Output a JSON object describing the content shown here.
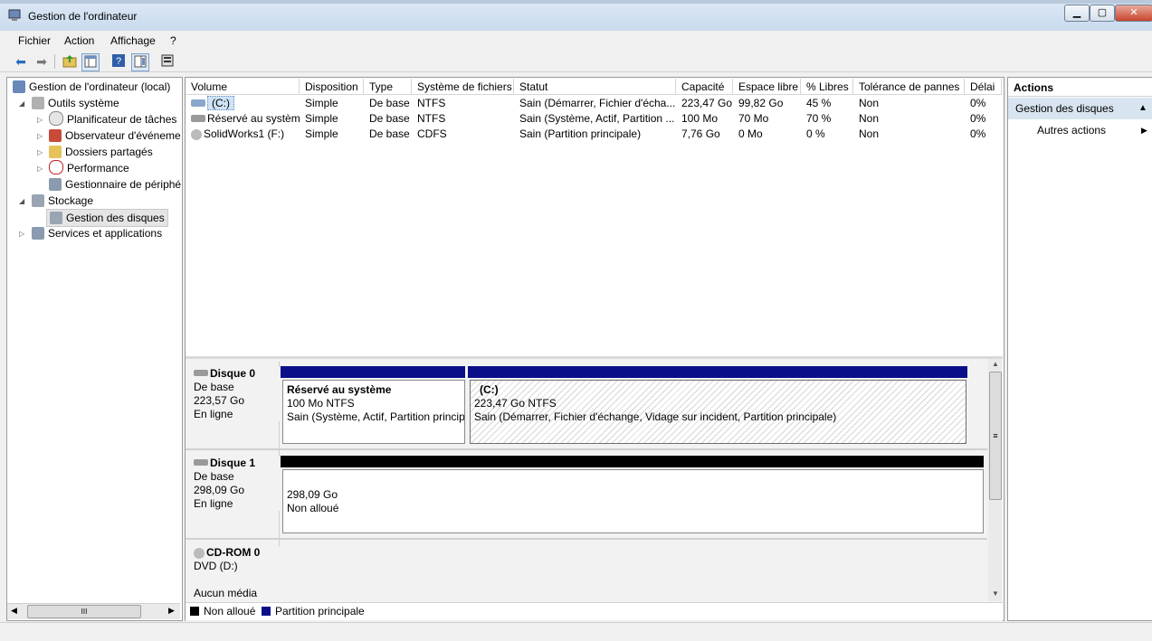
{
  "window": {
    "title": "Gestion de l'ordinateur"
  },
  "menu": [
    "Fichier",
    "Action",
    "Affichage",
    "?"
  ],
  "toolbar": [
    "back-icon",
    "forward-icon",
    "up-folder-icon",
    "show-tree-icon",
    "help-icon",
    "properties-icon",
    "export-icon"
  ],
  "nav": {
    "root": "Gestion de l'ordinateur (local)",
    "items": [
      {
        "label": "Outils système",
        "level": 1,
        "expanded": true,
        "icon": "tools-icon"
      },
      {
        "label": "Planificateur de tâches",
        "level": 2,
        "icon": "clock-icon"
      },
      {
        "label": "Observateur d'événeme",
        "level": 2,
        "icon": "event-viewer-icon"
      },
      {
        "label": "Dossiers partagés",
        "level": 2,
        "icon": "shared-folder-icon"
      },
      {
        "label": "Performance",
        "level": 2,
        "icon": "performance-icon"
      },
      {
        "label": "Gestionnaire de périphé",
        "level": 2,
        "icon": "device-manager-icon"
      },
      {
        "label": "Stockage",
        "level": 1,
        "expanded": true,
        "icon": "storage-icon"
      },
      {
        "label": "Gestion des disques",
        "level": 2,
        "selected": true,
        "icon": "disk-management-icon"
      },
      {
        "label": "Services et applications",
        "level": 1,
        "icon": "services-icon"
      }
    ],
    "hscroll_glyph": "III"
  },
  "volumes": {
    "columns": [
      "Volume",
      "Disposition",
      "Type",
      "Système de fichiers",
      "Statut",
      "Capacité",
      "Espace libre",
      "% Libres",
      "Tolérance de pannes",
      "Délai"
    ],
    "rows": [
      [
        "(C:)",
        "Simple",
        "De base",
        "NTFS",
        "Sain (Démarrer, Fichier d'écha...",
        "223,47 Go",
        "99,82 Go",
        "45 %",
        "Non",
        "0%"
      ],
      [
        "Réservé au système",
        "Simple",
        "De base",
        "NTFS",
        "Sain (Système, Actif, Partition ...",
        "100 Mo",
        "70 Mo",
        "70 %",
        "Non",
        "0%"
      ],
      [
        "SolidWorks1 (F:)",
        "Simple",
        "De base",
        "CDFS",
        "Sain (Partition principale)",
        "7,76 Go",
        "0 Mo",
        "0 %",
        "Non",
        "0%"
      ]
    ]
  },
  "disks": [
    {
      "name": "Disque 0",
      "type": "De base",
      "size": "223,57 Go",
      "state": "En ligne",
      "partitions": [
        {
          "name": "Réservé au système",
          "size": "100 Mo NTFS",
          "status": "Sain (Système, Actif, Partition princip"
        },
        {
          "name": "(C:)",
          "size": "223,47 Go NTFS",
          "status": "Sain (Démarrer, Fichier d'échange, Vidage sur incident, Partition principale)"
        }
      ]
    },
    {
      "name": "Disque 1",
      "type": "De base",
      "size": "298,09 Go",
      "state": "En ligne",
      "partitions": [
        {
          "name": "",
          "size": "298,09 Go",
          "status": "Non alloué"
        }
      ]
    },
    {
      "name": "CD-ROM 0",
      "type": "DVD (D:)",
      "size": "",
      "state": "Aucun média",
      "partitions": []
    }
  ],
  "legend": [
    {
      "label": "Non alloué",
      "color": "#000000"
    },
    {
      "label": "Partition principale",
      "color": "#0b0e89"
    }
  ],
  "actions": {
    "header": "Actions",
    "section": "Gestion des disques",
    "items": [
      "Autres actions"
    ]
  },
  "scrollbar_glyph": "≡"
}
